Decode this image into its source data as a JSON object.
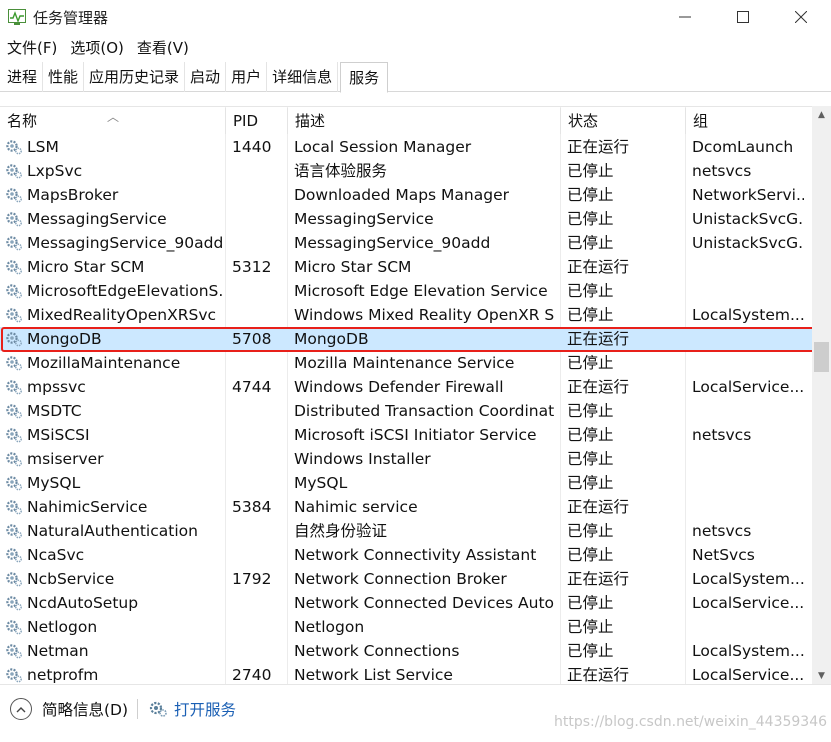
{
  "window": {
    "title": "任务管理器"
  },
  "menu": [
    "文件(F)",
    "选项(O)",
    "查看(V)"
  ],
  "tabs": [
    {
      "label": "进程",
      "active": false
    },
    {
      "label": "性能",
      "active": false
    },
    {
      "label": "应用历史记录",
      "active": false
    },
    {
      "label": "启动",
      "active": false
    },
    {
      "label": "用户",
      "active": false
    },
    {
      "label": "详细信息",
      "active": false
    },
    {
      "label": "服务",
      "active": true
    }
  ],
  "columns": {
    "name": "名称",
    "pid": "PID",
    "desc": "描述",
    "status": "状态",
    "group": "组"
  },
  "selected_row": "MongoDB",
  "highlight_color": "#e8201a",
  "services": [
    {
      "name": "LSM",
      "pid": "1440",
      "desc": "Local Session Manager",
      "status": "正在运行",
      "group": "DcomLaunch"
    },
    {
      "name": "LxpSvc",
      "pid": "",
      "desc": "语言体验服务",
      "status": "已停止",
      "group": "netsvcs"
    },
    {
      "name": "MapsBroker",
      "pid": "",
      "desc": "Downloaded Maps Manager",
      "status": "已停止",
      "group": "NetworkServi..."
    },
    {
      "name": "MessagingService",
      "pid": "",
      "desc": "MessagingService",
      "status": "已停止",
      "group": "UnistackSvcG..."
    },
    {
      "name": "MessagingService_90add",
      "pid": "",
      "desc": "MessagingService_90add",
      "status": "已停止",
      "group": "UnistackSvcG..."
    },
    {
      "name": "Micro Star SCM",
      "pid": "5312",
      "desc": "Micro Star SCM",
      "status": "正在运行",
      "group": ""
    },
    {
      "name": "MicrosoftEdgeElevationS...",
      "pid": "",
      "desc": "Microsoft Edge Elevation Service ...",
      "status": "已停止",
      "group": ""
    },
    {
      "name": "MixedRealityOpenXRSvc",
      "pid": "",
      "desc": "Windows Mixed Reality OpenXR S...",
      "status": "已停止",
      "group": "LocalSystem..."
    },
    {
      "name": "MongoDB",
      "pid": "5708",
      "desc": "MongoDB",
      "status": "正在运行",
      "group": ""
    },
    {
      "name": "MozillaMaintenance",
      "pid": "",
      "desc": "Mozilla Maintenance Service",
      "status": "已停止",
      "group": ""
    },
    {
      "name": "mpssvc",
      "pid": "4744",
      "desc": "Windows Defender Firewall",
      "status": "正在运行",
      "group": "LocalService..."
    },
    {
      "name": "MSDTC",
      "pid": "",
      "desc": "Distributed Transaction Coordinat...",
      "status": "已停止",
      "group": ""
    },
    {
      "name": "MSiSCSI",
      "pid": "",
      "desc": "Microsoft iSCSI Initiator Service",
      "status": "已停止",
      "group": "netsvcs"
    },
    {
      "name": "msiserver",
      "pid": "",
      "desc": "Windows Installer",
      "status": "已停止",
      "group": ""
    },
    {
      "name": "MySQL",
      "pid": "",
      "desc": "MySQL",
      "status": "已停止",
      "group": ""
    },
    {
      "name": "NahimicService",
      "pid": "5384",
      "desc": "Nahimic service",
      "status": "正在运行",
      "group": ""
    },
    {
      "name": "NaturalAuthentication",
      "pid": "",
      "desc": "自然身份验证",
      "status": "已停止",
      "group": "netsvcs"
    },
    {
      "name": "NcaSvc",
      "pid": "",
      "desc": "Network Connectivity Assistant",
      "status": "已停止",
      "group": "NetSvcs"
    },
    {
      "name": "NcbService",
      "pid": "1792",
      "desc": "Network Connection Broker",
      "status": "正在运行",
      "group": "LocalSystem..."
    },
    {
      "name": "NcdAutoSetup",
      "pid": "",
      "desc": "Network Connected Devices Auto...",
      "status": "已停止",
      "group": "LocalService..."
    },
    {
      "name": "Netlogon",
      "pid": "",
      "desc": "Netlogon",
      "status": "已停止",
      "group": ""
    },
    {
      "name": "Netman",
      "pid": "",
      "desc": "Network Connections",
      "status": "已停止",
      "group": "LocalSystem..."
    },
    {
      "name": "netprofm",
      "pid": "2740",
      "desc": "Network List Service",
      "status": "正在运行",
      "group": "LocalService..."
    }
  ],
  "footer": {
    "fewer_details": "简略信息(D)",
    "open_services": "打开服务",
    "watermark": "https://blog.csdn.net/weixin_44359346"
  }
}
